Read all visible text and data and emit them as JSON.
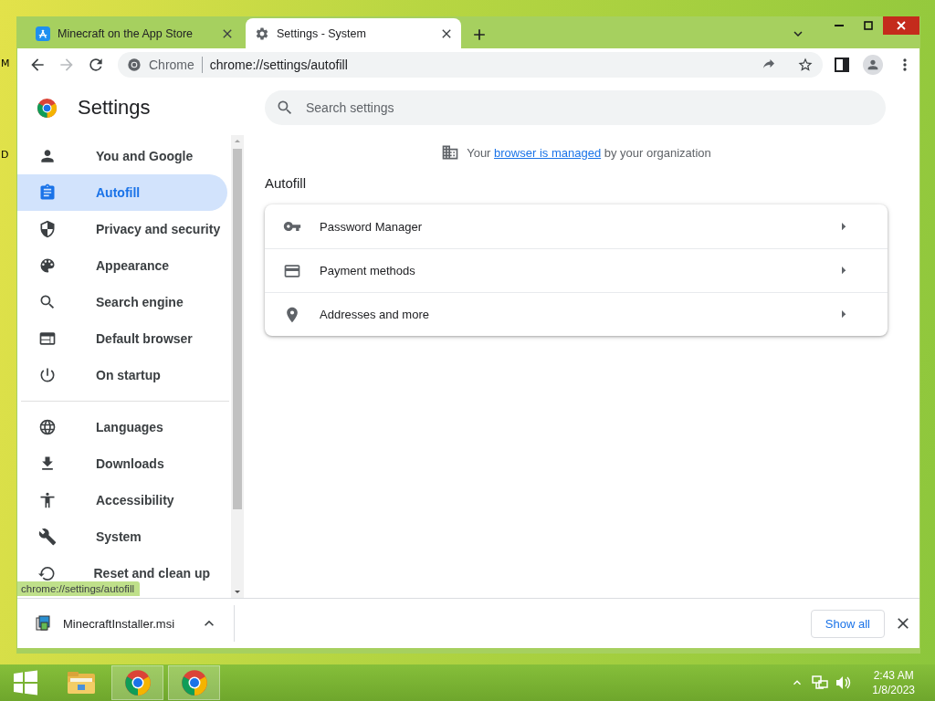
{
  "desktop_icon_labels": [
    "M",
    "D"
  ],
  "tabs": [
    {
      "title": "Minecraft on the App Store",
      "selected": false
    },
    {
      "title": "Settings - System",
      "selected": true
    }
  ],
  "toolbar": {
    "forward": {
      "disabled": true
    },
    "site_chip": "Chrome",
    "url": "chrome://settings/autofill"
  },
  "settings": {
    "title": "Settings",
    "search_placeholder": "Search settings",
    "nav_groups": [
      {
        "items": [
          {
            "label": "You and Google",
            "selected": false
          },
          {
            "label": "Autofill",
            "selected": true
          },
          {
            "label": "Privacy and security",
            "selected": false
          },
          {
            "label": "Appearance",
            "selected": false
          },
          {
            "label": "Search engine",
            "selected": false
          },
          {
            "label": "Default browser",
            "selected": false
          },
          {
            "label": "On startup",
            "selected": false
          }
        ]
      },
      {
        "items": [
          {
            "label": "Languages",
            "selected": false
          },
          {
            "label": "Downloads",
            "selected": false
          },
          {
            "label": "Accessibility",
            "selected": false
          },
          {
            "label": "System",
            "selected": false
          },
          {
            "label": "Reset and clean up",
            "selected": false
          }
        ]
      }
    ],
    "managed_notice": {
      "before": "Your",
      "link": "browser is managed",
      "after": "by your organization"
    },
    "section_title": "Autofill",
    "autofill_rows": [
      {
        "label": "Password Manager"
      },
      {
        "label": "Payment methods"
      },
      {
        "label": "Addresses and more"
      }
    ]
  },
  "status_bubble": "chrome://settings/autofill",
  "download_shelf": {
    "filename": "MinecraftInstaller.msi",
    "show_all": "Show all"
  },
  "taskbar": {
    "apps": [
      {
        "selected": false
      },
      {
        "selected": true
      },
      {
        "selected": true
      }
    ],
    "time": "2:43 AM",
    "date": "1/8/2023"
  }
}
